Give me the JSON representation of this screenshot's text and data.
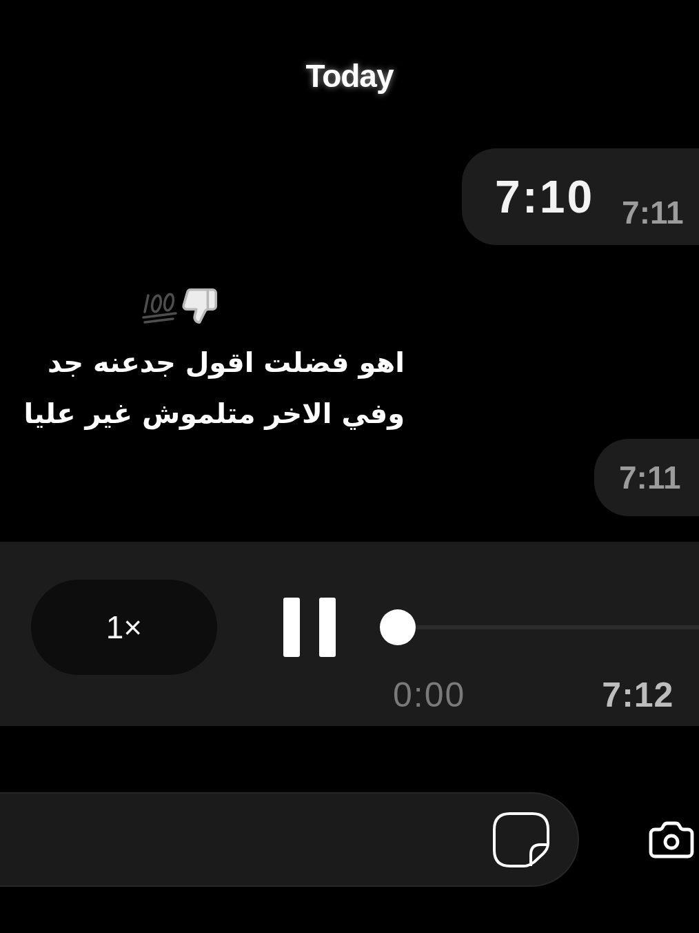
{
  "date_divider": {
    "label": "Today"
  },
  "items": [
    {
      "kind": "message",
      "text": "7:10",
      "time": "7:11"
    },
    {
      "kind": "caption",
      "lines": [
        "اهو فضلت اقول جدعنه جد",
        "وفي الاخر متلموش غير عليا"
      ]
    },
    {
      "kind": "message",
      "time": "7:11"
    }
  ],
  "audio_player": {
    "speed": "1×",
    "playing": true,
    "level": 0,
    "elapsed": "0:00",
    "time": "7:12"
  }
}
